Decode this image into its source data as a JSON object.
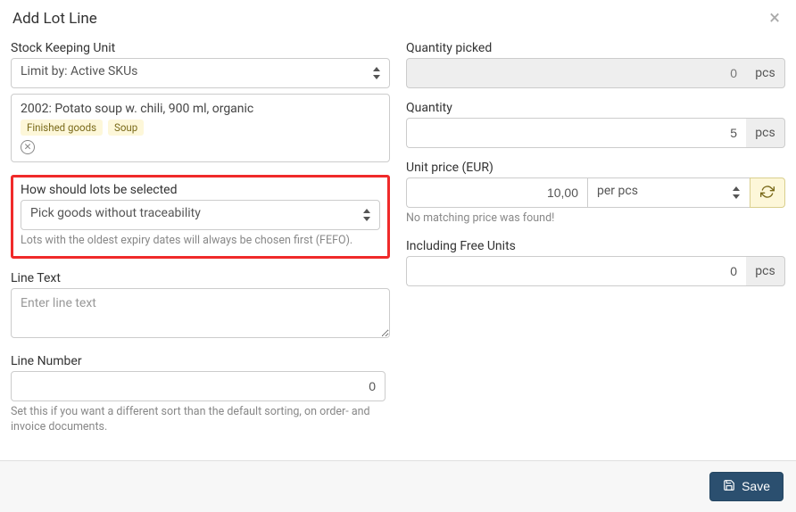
{
  "header": {
    "title": "Add Lot Line"
  },
  "left": {
    "sku": {
      "label": "Stock Keeping Unit",
      "limit_select": "Limit by: Active SKUs",
      "item_name": "2002: Potato soup w. chili, 900 ml, organic",
      "tags": [
        "Finished goods",
        "Soup"
      ]
    },
    "lot_select": {
      "label": "How should lots be selected",
      "value": "Pick goods without traceability",
      "help": "Lots with the oldest expiry dates will always be chosen first (FEFO)."
    },
    "line_text": {
      "label": "Line Text",
      "placeholder": "Enter line text"
    },
    "line_number": {
      "label": "Line Number",
      "value": "0",
      "help": "Set this if you want a different sort than the default sorting, on order- and invoice documents."
    }
  },
  "right": {
    "qty_picked": {
      "label": "Quantity picked",
      "value": "0",
      "unit": "pcs"
    },
    "qty": {
      "label": "Quantity",
      "value": "5",
      "unit": "pcs"
    },
    "unit_price": {
      "label": "Unit price (EUR)",
      "value": "10,00",
      "per": "per pcs",
      "help": "No matching price was found!"
    },
    "free_units": {
      "label": "Including Free Units",
      "value": "0",
      "unit": "pcs"
    }
  },
  "footer": {
    "save": "Save"
  }
}
